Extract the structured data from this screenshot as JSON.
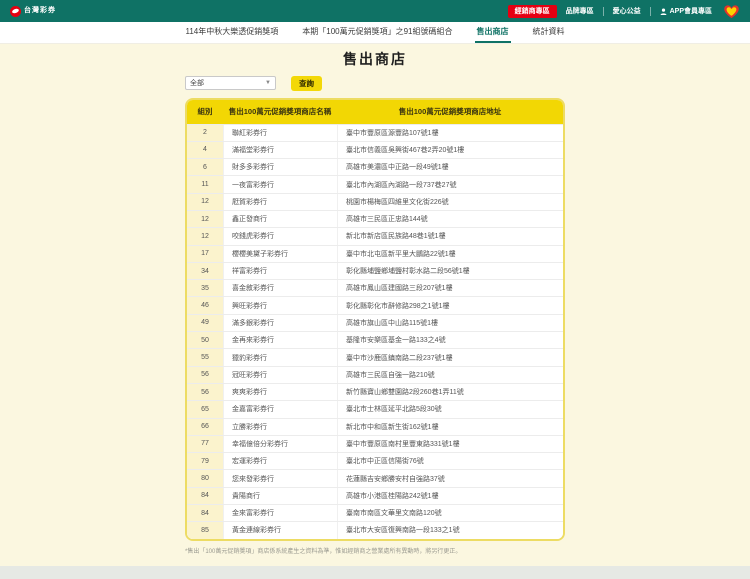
{
  "colors": {
    "brand_teal": "#0F7265",
    "accent_yellow": "#F2D704",
    "accent_red": "#E50012"
  },
  "topbar": {
    "logo_text": "台灣彩券",
    "dealer_button": "經銷商專區",
    "links": {
      "brand": "品牌專區",
      "charity": "愛心公益",
      "app": "APP會員專區"
    }
  },
  "nav": {
    "tabs": [
      {
        "label": "114年中秋大樂透促銷獎項",
        "active": false
      },
      {
        "label": "本期「100萬元促銷獎項」之91組號碼組合",
        "active": false
      },
      {
        "label": "售出商店",
        "active": true
      },
      {
        "label": "統計資料",
        "active": false
      }
    ]
  },
  "main": {
    "title": "售出商店",
    "filter": {
      "selected_option": "全部",
      "caret": "▼",
      "query_button": "查詢"
    },
    "table": {
      "headers": [
        "組別",
        "售出100萬元促銷獎項商店名稱",
        "售出100萬元促銷獎項商店地址"
      ],
      "rows": [
        [
          "2",
          "聯紅彩券行",
          "臺中市豐原區源豐路107號1樓"
        ],
        [
          "4",
          "滿福堂彩券行",
          "臺北市信義區吳興街467巷2弄20號1樓"
        ],
        [
          "6",
          "財多多彩券行",
          "高雄市美濃區中正路一段49號1樓"
        ],
        [
          "11",
          "一夜富彩券行",
          "臺北市內湖區內湖路一段737巷27號"
        ],
        [
          "12",
          "屘賀彩券行",
          "桃園市楊梅區四維里文化街226號"
        ],
        [
          "12",
          "鑫正發商行",
          "高雄市三民區正忠路144號"
        ],
        [
          "12",
          "咬錢虎彩券行",
          "新北市新店區民族路48巷1號1樓"
        ],
        [
          "17",
          "櫻櫻美黛子彩券行",
          "臺中市北屯區新平里大鵬路22號1樓"
        ],
        [
          "34",
          "祥富彩券行",
          "彰化縣埔鹽鄉埔鹽村彰水路二段56號1樓"
        ],
        [
          "35",
          "喜金敘彩券行",
          "高雄市鳳山區建國路三段207號1樓"
        ],
        [
          "46",
          "興旺彩券行",
          "彰化縣彰化市辭修路298之1號1樓"
        ],
        [
          "49",
          "滿多銀彩券行",
          "高雄市旗山區中山路115號1樓"
        ],
        [
          "50",
          "金再來彩券行",
          "基隆市安樂區基金一路133之4號"
        ],
        [
          "55",
          "獵豹彩券行",
          "臺中市沙鹿區鎮南路二段237號1樓"
        ],
        [
          "56",
          "冠旺彩券行",
          "高雄市三民區自強一路210號"
        ],
        [
          "56",
          "爽爽彩券行",
          "新竹縣寶山鄉雙園路2段260巷1弄11號"
        ],
        [
          "65",
          "金嘉富彩券行",
          "臺北市士林區延平北路5段30號"
        ],
        [
          "66",
          "立勝彩券行",
          "新北市中和區新生街162號1樓"
        ],
        [
          "77",
          "幸福億倍分彩券行",
          "臺中市豐原區南村里豐東路331號1樓"
        ],
        [
          "79",
          "宏運彩券行",
          "臺北市中正區信陽街76號"
        ],
        [
          "80",
          "您來發彩券行",
          "花蓮縣吉安鄉勝安村自強路37號"
        ],
        [
          "84",
          "貴陽商行",
          "高雄市小港區桂陽路242號1樓"
        ],
        [
          "84",
          "金來富彩券行",
          "臺南市南區文華里文南路120號"
        ],
        [
          "85",
          "黃金連線彩券行",
          "臺北市大安區復興南路一段133之1號"
        ]
      ]
    },
    "footnote": "*售出「100萬元促銷獎項」商店係系統產生之資料為準，惟如經銷商之營業處所有異動時，將另行更正。"
  }
}
